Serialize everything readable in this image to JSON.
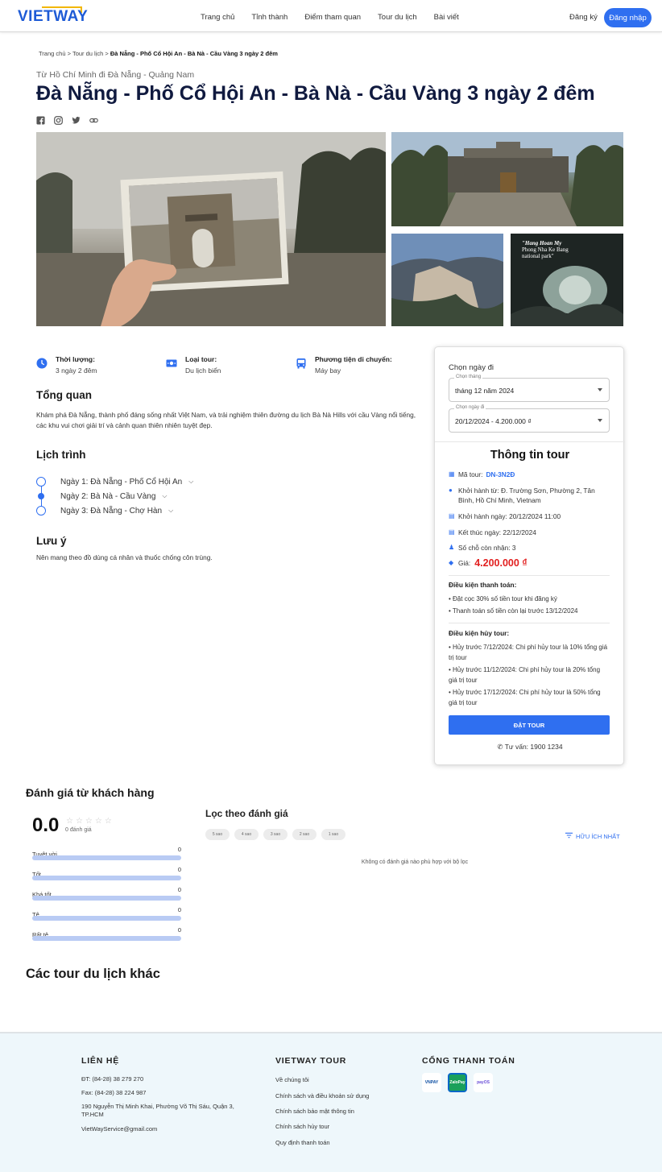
{
  "brand": {
    "name": "VIETWAY",
    "accent": "#2f6ff0",
    "accent_gold": "#f2b705"
  },
  "nav": {
    "items": [
      "Trang chủ",
      "Tỉnh thành",
      "Điểm tham quan",
      "Tour du lịch",
      "Bài viết"
    ],
    "register": "Đăng ký",
    "login": "Đăng nhập"
  },
  "breadcrumb": {
    "home": "Trang chủ",
    "sep": ">",
    "tours": "Tour du lịch",
    "current": "Đà Nẵng - Phố Cổ Hội An - Bà Nà - Cầu Vàng 3 ngày 2 đêm"
  },
  "tour": {
    "route": "Từ Hồ Chí Minh đi Đà Nẵng - Quảng Nam",
    "title": "Đà Nẵng - Phố Cổ Hội An - Bà Nà - Cầu Vàng 3 ngày 2 đêm",
    "share_icons": [
      "facebook-icon",
      "instagram-icon",
      "twitter-icon",
      "link-icon"
    ],
    "gallery_caption": {
      "title": "\"Hang Hoan My",
      "sub": "Phong Nha Ke Bang",
      "sub2": "national park\""
    }
  },
  "info": [
    {
      "icon": "clock-icon",
      "label": "Thời lượng:",
      "value": "3 ngày 2 đêm"
    },
    {
      "icon": "money-icon",
      "label": "Loại tour:",
      "value": "Du lịch biển"
    },
    {
      "icon": "bus-icon",
      "label": "Phương tiện di chuyển:",
      "value": "Máy bay"
    }
  ],
  "overview": {
    "heading": "Tổng quan",
    "text": "Khám phá Đà Nẵng, thành phố đáng sống nhất Việt Nam, và trải nghiệm thiên đường du lịch Bà Nà Hills với cầu Vàng nổi tiếng, các khu vui chơi giải trí và cảnh quan thiên nhiên tuyệt đẹp."
  },
  "itinerary": {
    "heading": "Lịch trình",
    "days": [
      "Ngày 1: Đà Nẵng - Phố Cổ Hội An",
      "Ngày 2: Bà Nà - Cầu Vàng",
      "Ngày 3: Đà Nẵng - Chợ Hàn"
    ]
  },
  "notes": {
    "heading": "Lưu ý",
    "text": "Nên mang theo đồ dùng cá nhân và thuốc chống côn trùng."
  },
  "booking": {
    "pick_label": "Chọn ngày đi",
    "month_field": {
      "label": "Chọn tháng",
      "value": "tháng 12 năm 2024"
    },
    "date_field": {
      "label": "Chọn ngày đi",
      "value": "20/12/2024 - 4.200.000 ₫"
    },
    "info_title": "Thông tin tour",
    "code_label": "Mã tour:",
    "code": "DN-3N2Đ",
    "depart_from": "Khởi hành từ: Đ. Trường Sơn, Phường 2, Tân Bình, Hồ Chí Minh, Vietnam",
    "depart_date": "Khởi hành ngày: 20/12/2024 11:00",
    "end_date": "Kết thúc ngày: 22/12/2024",
    "seats": "Số chỗ còn nhận: 3",
    "price_label": "Giá:",
    "price": "4.200.000 ₫",
    "payment_heading": "Điều kiện thanh toán:",
    "payment": [
      "• Đặt cọc 30% số tiền tour khi đăng ký",
      "• Thanh toán số tiền còn lại trước 13/12/2024"
    ],
    "cancel_heading": "Điều kiện hủy tour:",
    "cancel": [
      "• Hủy trước 7/12/2024: Chi phí hủy tour là 10% tổng giá trị tour",
      "• Hủy trước 11/12/2024: Chi phí hủy tour là 20% tổng giá trị tour",
      "• Hủy trước 17/12/2024: Chi phí hủy tour là 50% tổng giá trị tour"
    ],
    "book_button": "ĐẶT TOUR",
    "hotline": "Tư vấn: 1900 1234"
  },
  "reviews": {
    "heading": "Đánh giá từ khách hàng",
    "score": "0.0",
    "stars": "☆☆☆☆☆",
    "count": "0 đánh giá",
    "bars": [
      {
        "label": "Tuyệt vời",
        "count": "0"
      },
      {
        "label": "Tốt",
        "count": "0"
      },
      {
        "label": "Khá tốt",
        "count": "0"
      },
      {
        "label": "Tệ",
        "count": "0"
      },
      {
        "label": "Rất tệ",
        "count": "0"
      }
    ],
    "filter_heading": "Lọc theo đánh giá",
    "chips": [
      "5 sao",
      "4 sao",
      "3 sao",
      "2 sao",
      "1 sao"
    ],
    "sort": "HỮU ÍCH NHẤT",
    "empty": "Không có đánh giá nào phù hợp với bộ lọc"
  },
  "other_tours": {
    "heading": "Các tour du lịch khác"
  },
  "footer": {
    "contact": {
      "heading": "LIÊN HỆ",
      "phone": "ĐT: (84-28) 38 279 270",
      "fax": "Fax: (84-28) 38 224 987",
      "address": "190 Nguyễn Thị Minh Khai, Phường Võ Thị Sáu, Quận 3, TP.HCM",
      "email": "VietWayService@gmail.com"
    },
    "company": {
      "heading": "VIETWAY TOUR",
      "links": [
        "Về chúng tôi",
        "Chính sách và điều khoản sử dụng",
        "Chính sách bảo mật thông tin",
        "Chính sách hủy tour",
        "Quy định thanh toán"
      ]
    },
    "payment": {
      "heading": "CỔNG THANH TOÁN",
      "methods": [
        "VNPAY",
        "ZaloPay",
        "payOS"
      ]
    }
  }
}
